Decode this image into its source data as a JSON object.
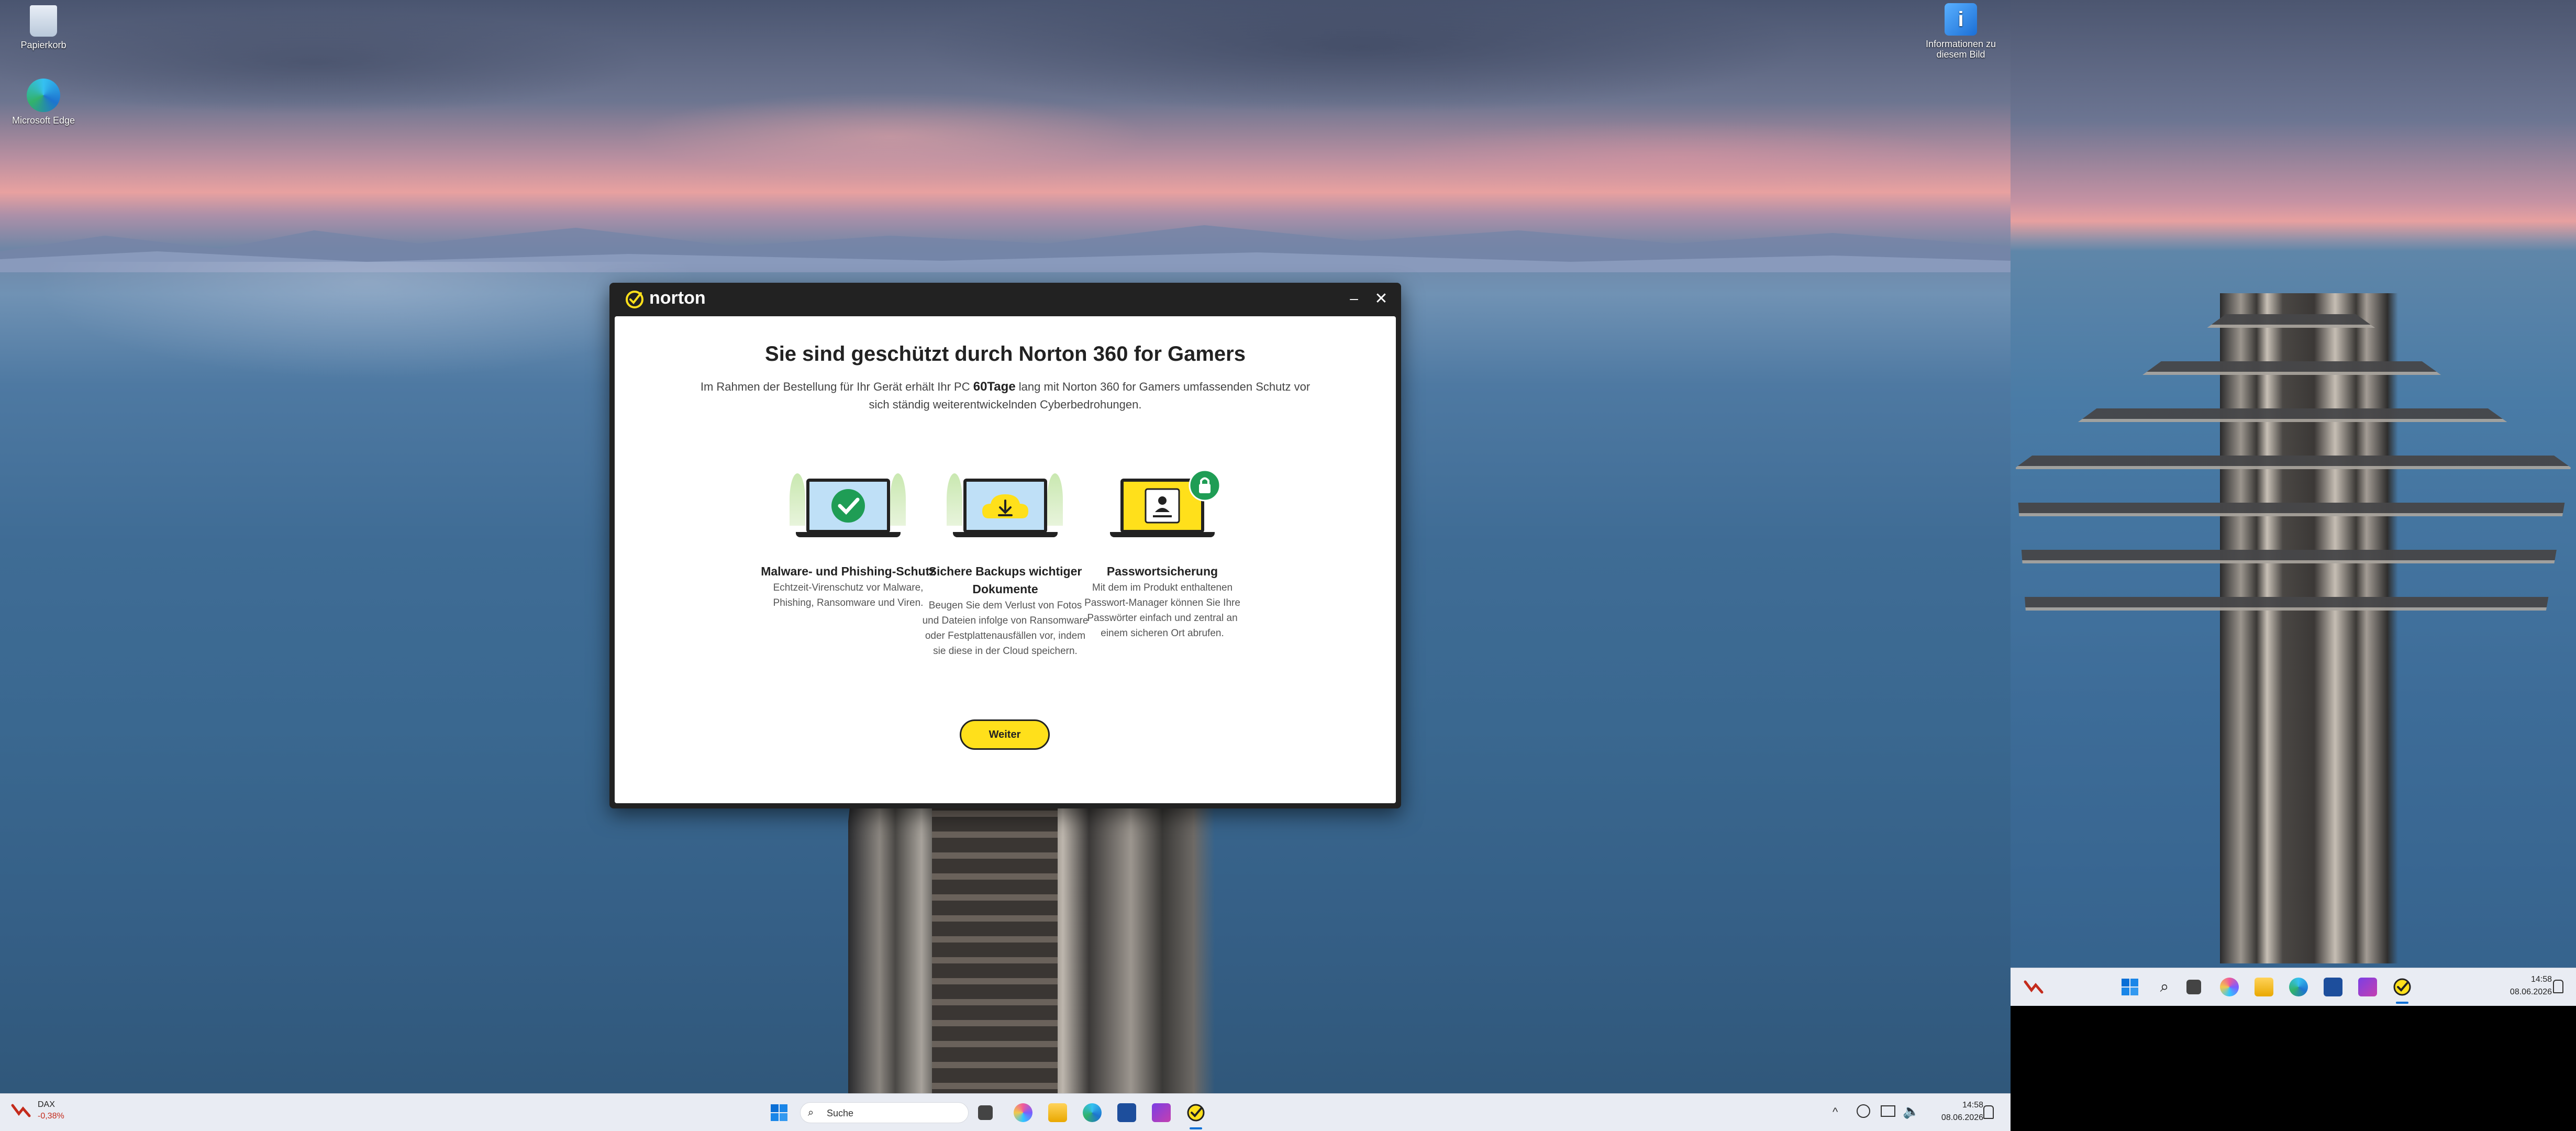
{
  "desktop": {
    "icons": [
      {
        "label": "Papierkorb"
      },
      {
        "label": "Microsoft Edge"
      },
      {
        "label": "Informationen zu diesem Bild"
      }
    ]
  },
  "norton": {
    "brand": "norton",
    "minimize_glyph": "–",
    "close_glyph": "✕",
    "headline": "Sie sind geschützt durch Norton 360 for Gamers",
    "subtitle_pre": "Im Rahmen der Bestellung für Ihr Gerät erhält Ihr PC ",
    "subtitle_bold": "60Tage",
    "subtitle_post": " lang mit Norton 360 for Gamers umfassenden Schutz vor sich ständig weiterentwickelnden Cyberbedrohungen.",
    "features": [
      {
        "title": "Malware- und Phishing-Schutz",
        "desc": "Echtzeit-Virenschutz vor Malware, Phishing, Ransomware und Viren.",
        "icon": "check-icon"
      },
      {
        "title": "Sichere Backups wichtiger Dokumente",
        "desc": "Beugen Sie dem Verlust von Fotos und Dateien infolge von Ransomware oder Festplattenausfällen vor, indem sie diese in der Cloud speichern.",
        "icon": "download-icon"
      },
      {
        "title": "Passwortsicherung",
        "desc": "Mit dem im Produkt enthaltenen Passwort-Manager können Sie Ihre Passwörter einfach und zentral an einem sicheren Ort abrufen.",
        "icon": "lock-icon"
      }
    ],
    "button_label": "Weiter"
  },
  "taskbar": {
    "widget_name": "DAX",
    "widget_value": "-0,38%",
    "search_placeholder": "Suche",
    "time": "14:58",
    "date": "08.06.2026"
  },
  "taskbar2": {
    "time": "14:58",
    "date": "08.06.2026"
  },
  "colors": {
    "norton_yellow": "#ffe01b",
    "norton_dark": "#222222",
    "accent_green": "#1f9d55"
  }
}
